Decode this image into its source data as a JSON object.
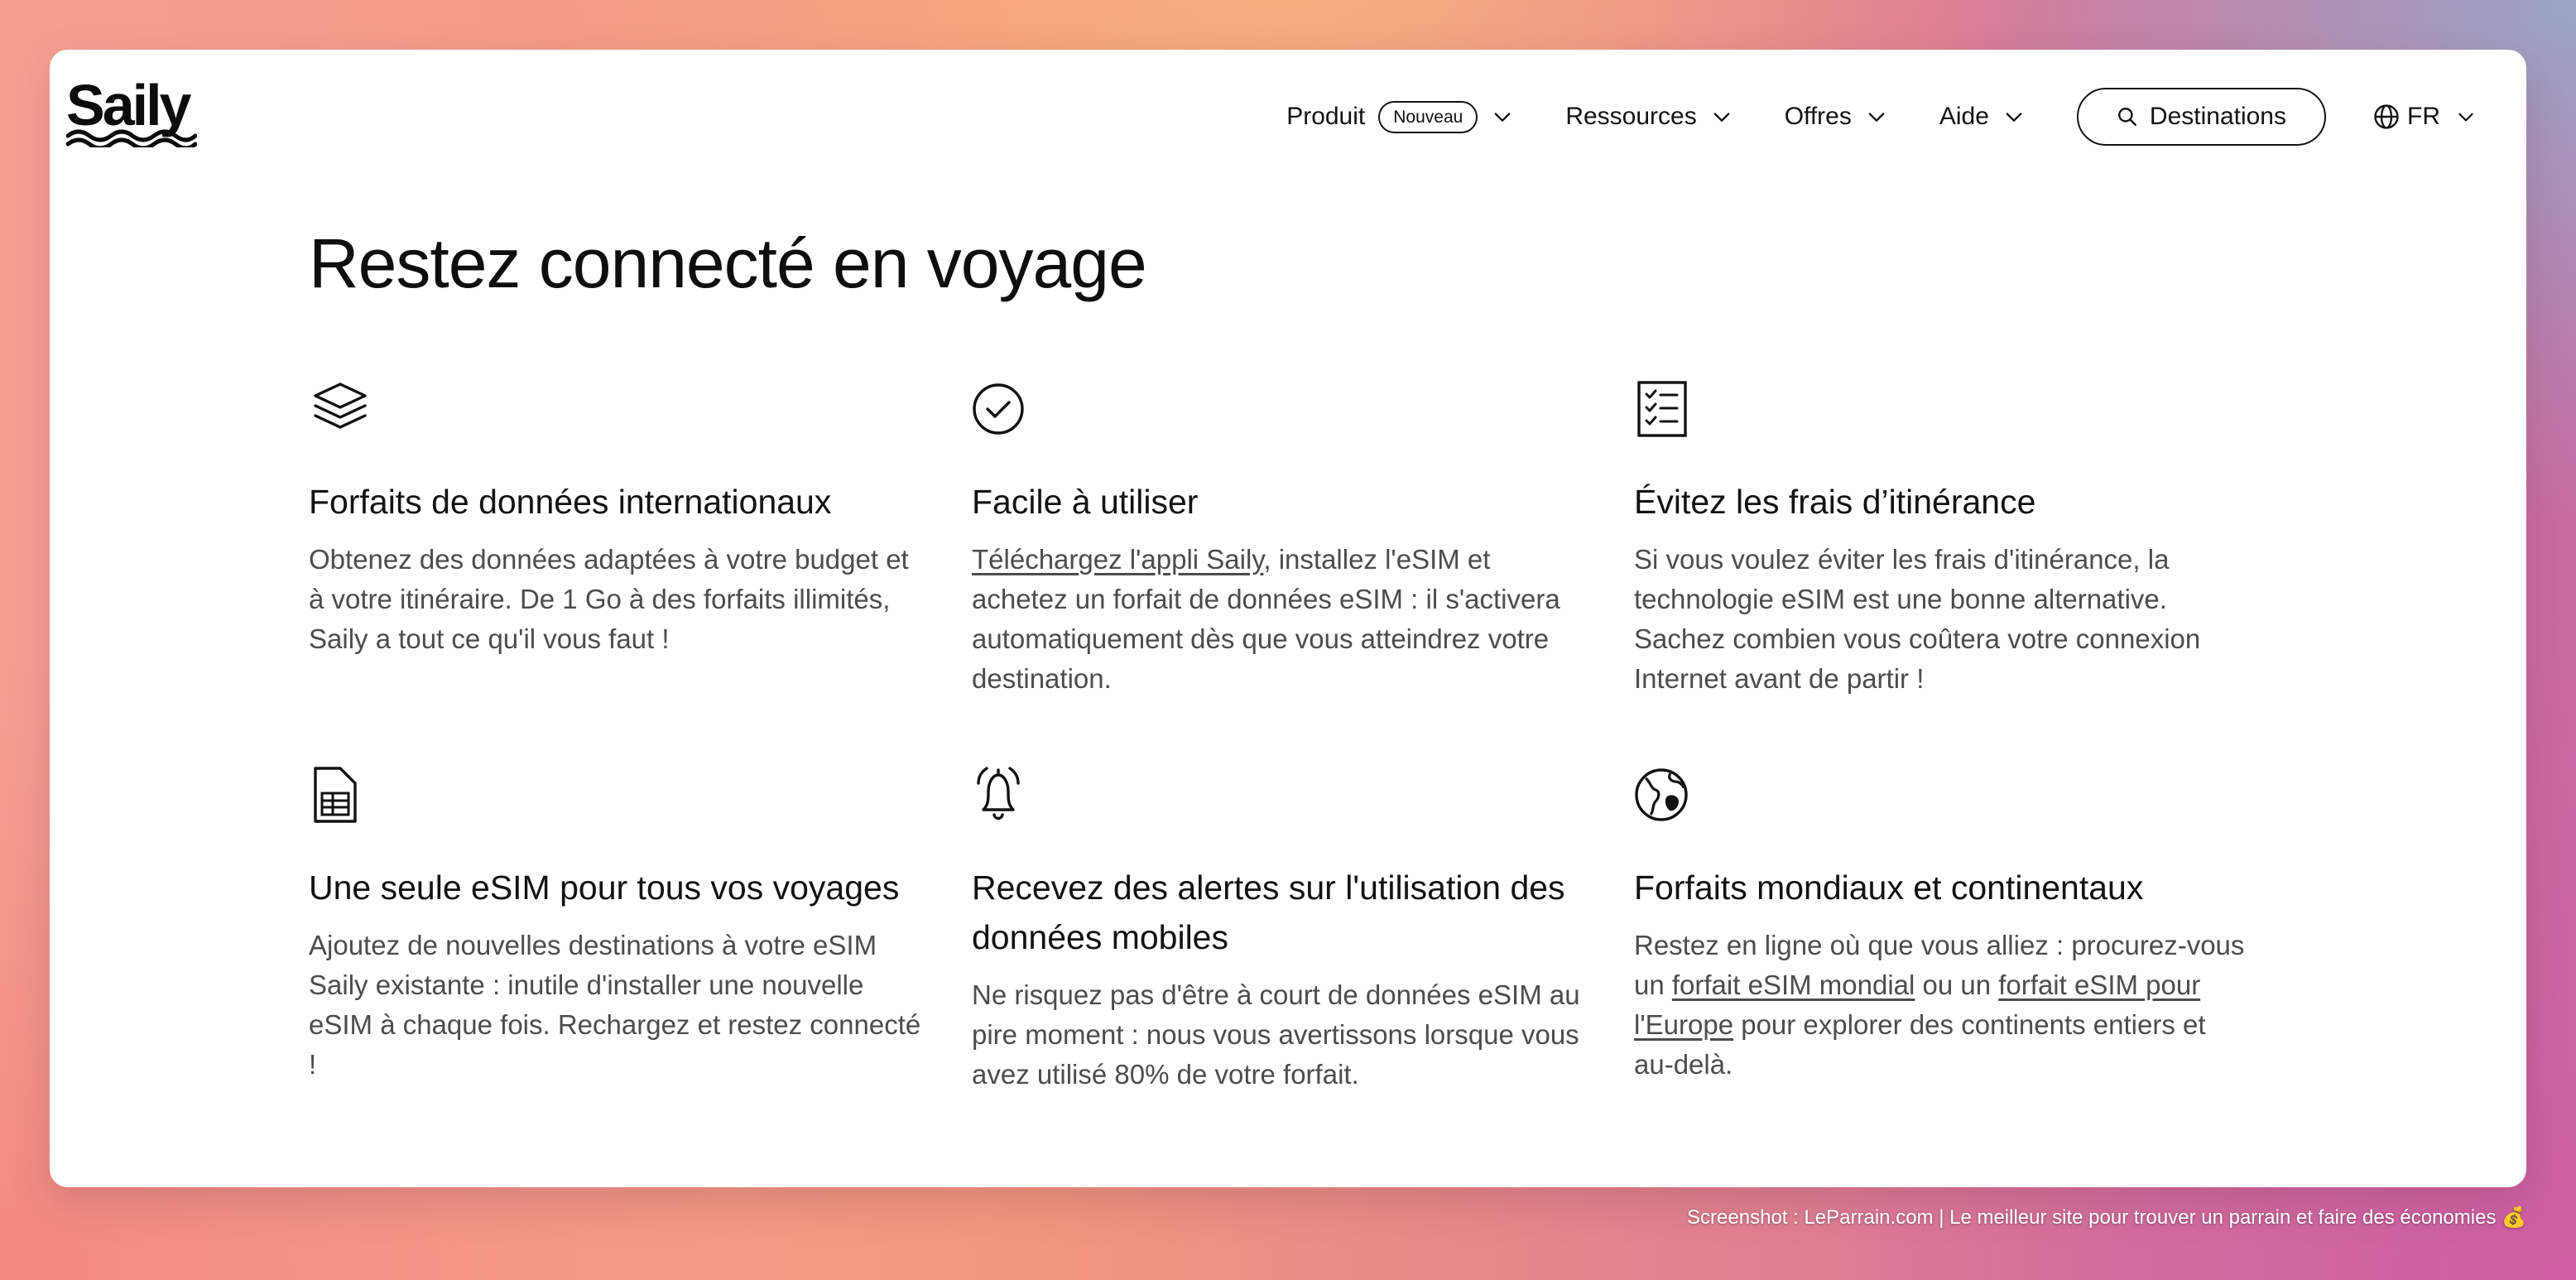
{
  "brand": {
    "name": "Saily"
  },
  "nav": {
    "produit": "Produit",
    "produit_badge": "Nouveau",
    "ressources": "Ressources",
    "offres": "Offres",
    "aide": "Aide",
    "destinations": "Destinations",
    "language": "FR"
  },
  "main": {
    "title": "Restez connecté en voyage",
    "features": [
      {
        "icon": "layers-icon",
        "title": "Forfaits de données internationaux",
        "text": "Obtenez des données adaptées à votre budget et à votre itinéraire. De 1 Go à des forfaits illimités, Saily a tout ce qu'il vous faut !"
      },
      {
        "icon": "check-circle-icon",
        "title": "Facile à utiliser",
        "link": "Téléchargez l'appli Saily",
        "text": ", installez l'eSIM et achetez un forfait de données eSIM : il s'activera automatiquement dès que vous atteindrez votre destination."
      },
      {
        "icon": "checklist-icon",
        "title": "Évitez les frais d’itinérance",
        "text": "Si vous voulez éviter les frais d'itinérance, la technologie eSIM est une bonne alternative. Sachez combien vous coûtera votre connexion Internet avant de partir !"
      },
      {
        "icon": "sim-card-icon",
        "title": "Une seule eSIM pour tous vos voyages",
        "text": "Ajoutez de nouvelles destinations à votre eSIM Saily existante : inutile d'installer une nouvelle eSIM à chaque fois. Rechargez et restez connecté !"
      },
      {
        "icon": "bell-icon",
        "title": "Recevez des alertes sur l'utilisation des données mobiles",
        "text": "Ne risquez pas d'être à court de données eSIM au pire moment : nous vous avertissons lorsque vous avez utilisé 80% de votre forfait."
      },
      {
        "icon": "globe-icon",
        "title": "Forfaits mondiaux et continentaux",
        "text_a": "Restez en ligne où que vous alliez : procurez-vous un ",
        "link_a": "forfait eSIM mondial",
        "text_b": " ou un ",
        "link_b": "forfait eSIM pour l'Europe",
        "text_c": " pour explorer des continents entiers et au-delà."
      }
    ]
  },
  "footer": {
    "credit": "Screenshot : LeParrain.com | Le meilleur site pour trouver un parrain et faire des économies 💰"
  }
}
